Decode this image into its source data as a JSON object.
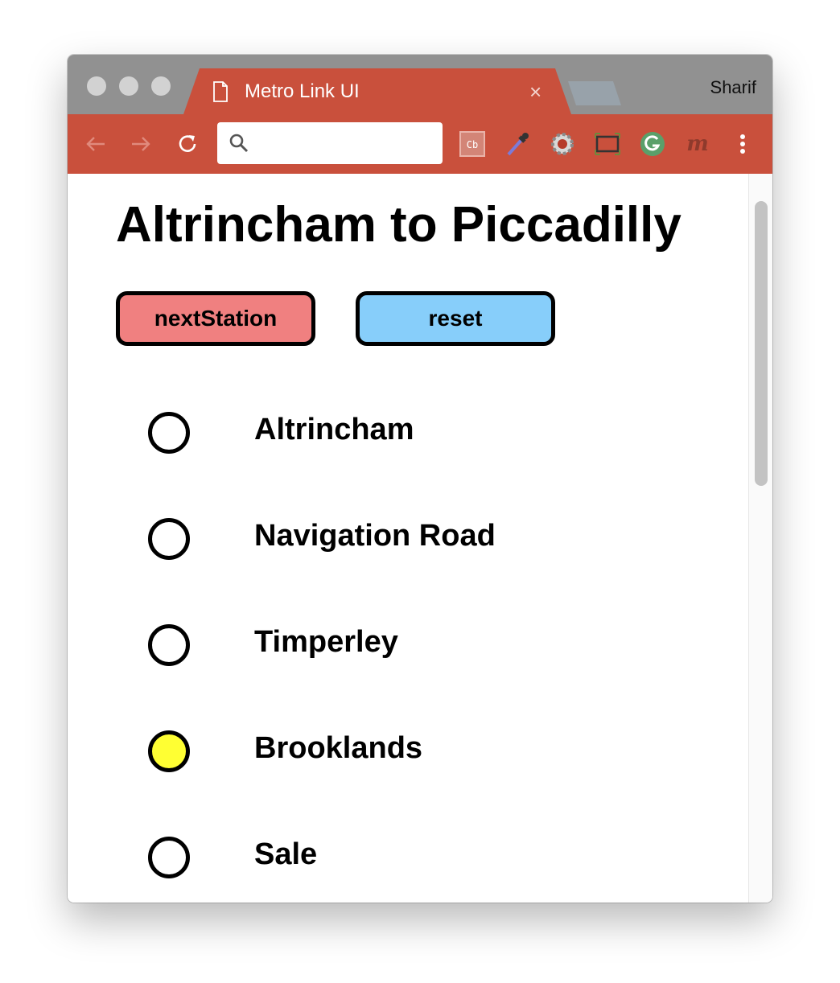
{
  "browser": {
    "tab_title": "Metro Link UI",
    "tab_close": "×",
    "profile_name": "Sharif",
    "address": {
      "value": "",
      "placeholder": ""
    },
    "extensions": [
      "cb-extension-icon",
      "color-picker-icon",
      "settings-gear-icon",
      "screen-capture-icon",
      "grammarly-icon",
      "m-extension-icon"
    ]
  },
  "page": {
    "title": "Altrincham to Piccadilly",
    "buttons": {
      "next_label": "nextStation",
      "reset_label": "reset"
    },
    "stations": [
      {
        "name": "Altrincham",
        "current": false
      },
      {
        "name": "Navigation Road",
        "current": false
      },
      {
        "name": "Timperley",
        "current": false
      },
      {
        "name": "Brooklands",
        "current": true
      },
      {
        "name": "Sale",
        "current": false
      }
    ]
  },
  "colors": {
    "browser_accent": "#c9503c",
    "next_button": "#f08080",
    "reset_button": "#87cefa",
    "current_station": "#ffff33"
  }
}
